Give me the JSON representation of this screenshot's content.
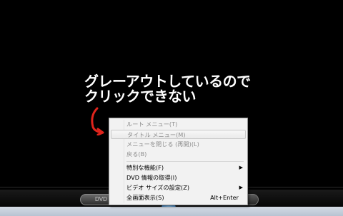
{
  "annotation": {
    "line1": "グレーアウトしているので",
    "line2": "クリックできない"
  },
  "player": {
    "dvd_label": "DVD"
  },
  "context_menu": {
    "items": [
      {
        "label": "ルート メニュー(T)",
        "enabled": false
      },
      {
        "label": "タイトル メニュー(M)",
        "enabled": false
      },
      {
        "label": "メニューを閉じる (再開)(L)",
        "enabled": false
      },
      {
        "label": "戻る(B)",
        "enabled": false
      },
      {
        "label": "特別な機能(F)",
        "enabled": true,
        "submenu": true
      },
      {
        "label": "DVD 情報の取得(I)",
        "enabled": true
      },
      {
        "label": "ビデオ サイズの設定(Z)",
        "enabled": true,
        "submenu": true
      },
      {
        "label": "全画面表示(S)",
        "enabled": true,
        "shortcut": "Alt+Enter"
      }
    ]
  },
  "icons": {
    "submenu_arrow": "▶",
    "annotation_arrow": "red-curved-arrow"
  },
  "colors": {
    "annotation_arrow": "#e0241c",
    "disabled_text": "#8d8d8d"
  }
}
